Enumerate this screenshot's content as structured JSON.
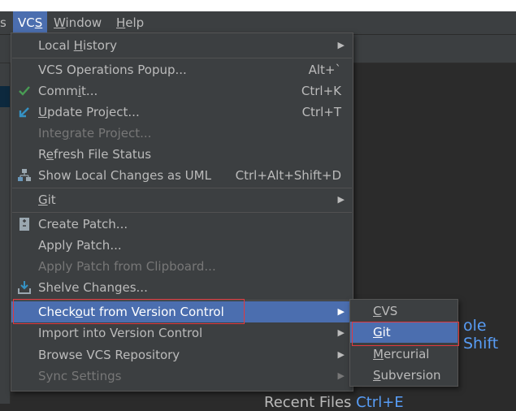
{
  "menubar": {
    "partial_left": "s",
    "vcs": "VCS",
    "window": "Window",
    "help": "Help"
  },
  "vcs_menu": {
    "local_history": "Local History",
    "ops_popup": "VCS Operations Popup...",
    "ops_popup_sc": "Alt+`",
    "commit": "Commit...",
    "commit_sc": "Ctrl+K",
    "update": "Update Project...",
    "update_sc": "Ctrl+T",
    "integrate": "Integrate Project...",
    "refresh": "Refresh File Status",
    "show_uml": "Show Local Changes as UML",
    "show_uml_sc": "Ctrl+Alt+Shift+D",
    "git": "Git",
    "create_patch": "Create Patch...",
    "apply_patch": "Apply Patch...",
    "apply_clipboard": "Apply Patch from Clipboard...",
    "shelve": "Shelve Changes...",
    "checkout": "Checkout from Version Control",
    "import": "Import into Version Control",
    "browse": "Browse VCS Repository",
    "sync": "Sync Settings"
  },
  "checkout_submenu": {
    "cvs": "CVS",
    "git": "Git",
    "mercurial": "Mercurial",
    "subversion": "Subversion"
  },
  "background": {
    "search_hint": "ole Shift",
    "recent_files": "Recent Files",
    "recent_files_key": "Ctrl+E"
  },
  "icons": {
    "commit": "checkmark-icon",
    "update": "update-arrow-icon",
    "show_uml": "uml-icon",
    "create_patch": "patch-icon",
    "shelve": "shelve-icon",
    "submenu": "chevron-right-icon"
  },
  "colors": {
    "menu_bg": "#3c3f41",
    "highlight": "#4b6eaf",
    "annotation_red": "#e0393e",
    "link_blue": "#589df6",
    "commit_green": "#499c54"
  }
}
